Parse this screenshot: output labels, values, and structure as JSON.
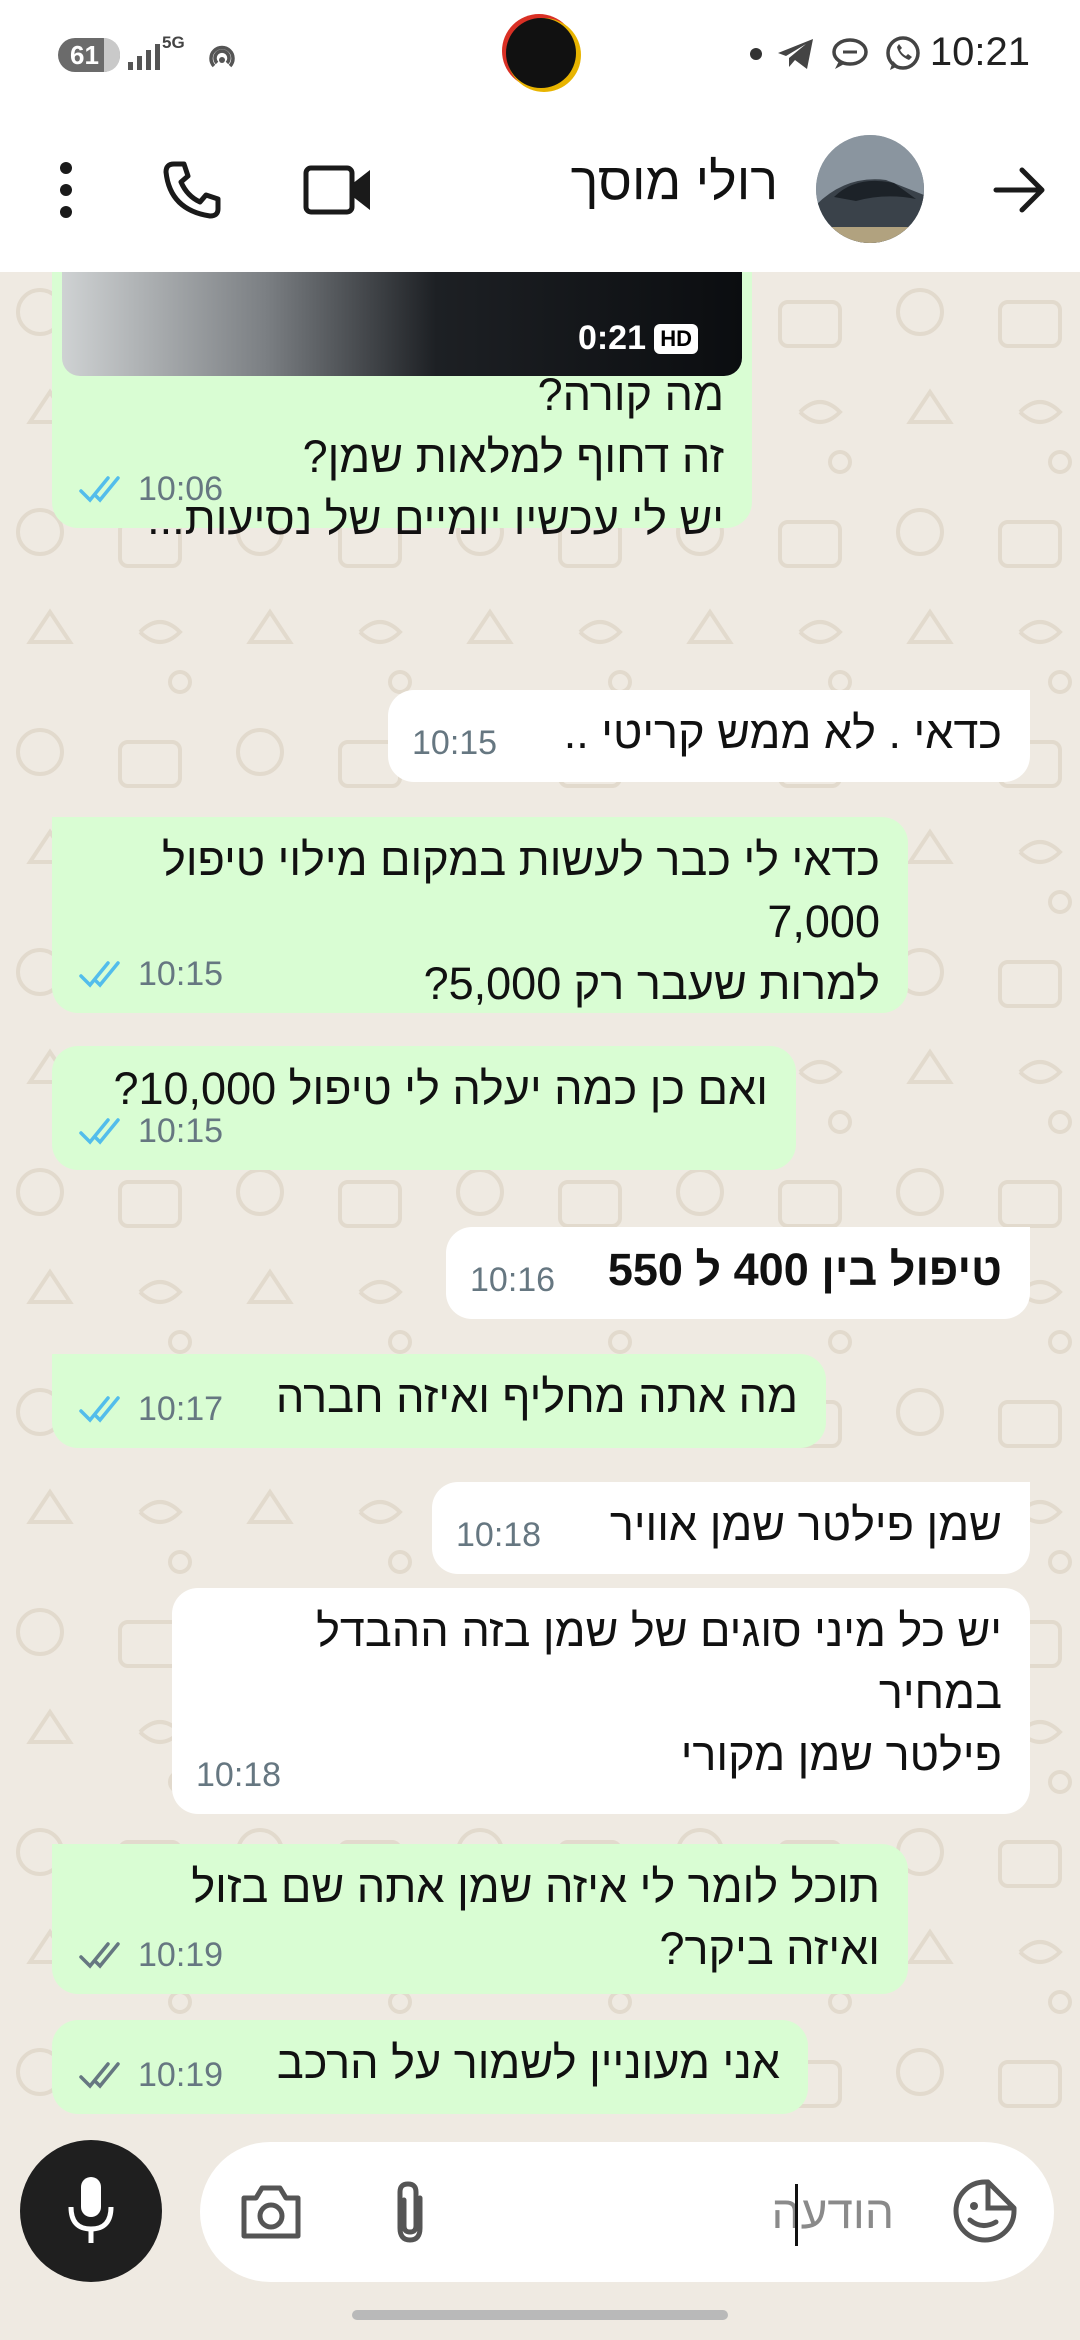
{
  "status": {
    "battery": "61",
    "network": "5G",
    "time": "10:21"
  },
  "header": {
    "contact_name": "רולי מוסך",
    "icons": [
      "arrow-right-icon",
      "avatar",
      "video-call-icon",
      "phone-icon",
      "more-vert-icon"
    ]
  },
  "colors": {
    "outgoing_bubble": "#d9fdd3",
    "incoming_bubble": "#ffffff",
    "read_ticks": "#53bdeb",
    "delivered_ticks": "#667781",
    "chat_background": "#efeae2"
  },
  "messages": [
    {
      "dir": "out",
      "video_duration": "0:21",
      "video_badge": "HD",
      "text": "מה קורה?\nזה דחוף למלאות שמן?\nיש לי עכשיו יומיים של נסיעות...",
      "time": "10:06",
      "status": "read"
    },
    {
      "dir": "in",
      "text": "כדאי . לא ממש קריטי ..",
      "time": "10:15"
    },
    {
      "dir": "out",
      "text": "כדאי לי כבר לעשות במקום מילוי טיפול 7,000\nלמרות שעבר רק 5,000?",
      "time": "10:15",
      "status": "read"
    },
    {
      "dir": "out",
      "text": "ואם כן כמה יעלה לי טיפול 10,000?",
      "time": "10:15",
      "status": "read"
    },
    {
      "dir": "in",
      "text": "טיפול בין 400 ל 550",
      "time": "10:16"
    },
    {
      "dir": "out",
      "text": "מה אתה מחליף ואיזה חברה",
      "time": "10:17",
      "status": "read"
    },
    {
      "dir": "in",
      "text": "שמן פילטר שמן אוויר",
      "time": "10:18"
    },
    {
      "dir": "in",
      "text": "יש כל מיני סוגים של שמן בזה ההבדל במחיר\nפילטר שמן מקורי",
      "time": "10:18"
    },
    {
      "dir": "out",
      "text": "תוכל לומר לי איזה שמן אתה שם בזול ואיזה ביקר?",
      "time": "10:19",
      "status": "delivered"
    },
    {
      "dir": "out",
      "text": "אני מעוניין לשמור על הרכב",
      "time": "10:19",
      "status": "delivered"
    }
  ],
  "input": {
    "placeholder": "הודעה"
  }
}
